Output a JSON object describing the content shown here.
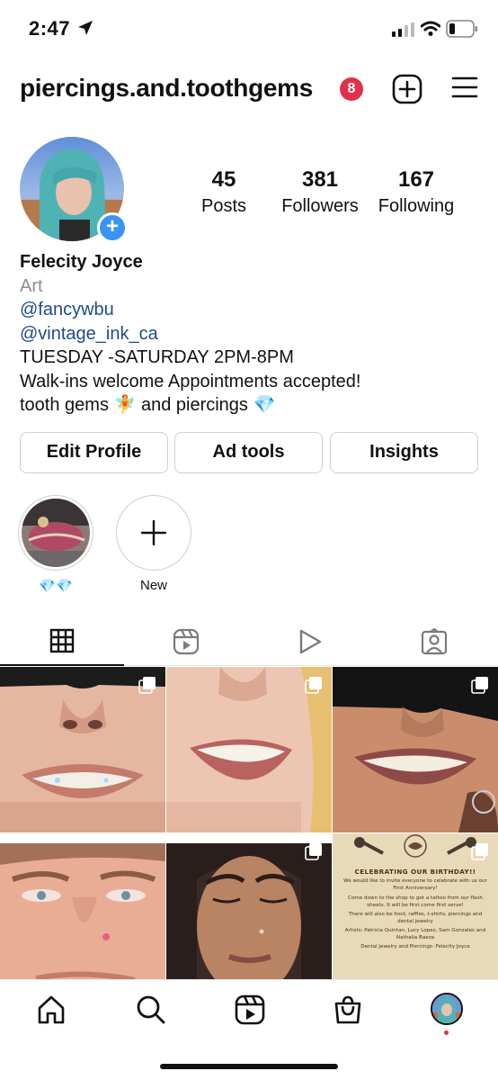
{
  "status_bar": {
    "time": "2:47"
  },
  "header": {
    "username": "piercings.and.toothgems",
    "notification_count": "8"
  },
  "profile": {
    "stats": [
      {
        "value": "45",
        "label": "Posts"
      },
      {
        "value": "381",
        "label": "Followers"
      },
      {
        "value": "167",
        "label": "Following"
      }
    ],
    "name": "Felecity Joyce",
    "category": "Art",
    "mentions": [
      "@fancywbu",
      "@vintage_ink_ca"
    ],
    "hours": "TUESDAY -SATURDAY 2PM-8PM",
    "bio_line_1": "Walk-ins welcome Appointments accepted!",
    "bio_line_2": "tooth gems 🧚 and piercings 💎"
  },
  "buttons": {
    "edit_profile": "Edit Profile",
    "ad_tools": "Ad tools",
    "insights": "Insights"
  },
  "highlights": [
    {
      "label": "💎💎"
    },
    {
      "label": "New"
    }
  ],
  "tabs": [
    "grid-tab",
    "reels-tab",
    "videos-tab",
    "tagged-tab"
  ],
  "poster": {
    "title": "CELEBRATING OUR BIRTHDAY!!",
    "line1": "We would like to invite everyone to celebrate with us our First Anniversary!",
    "line2": "Come down to the shop to get a tattoo from our flash sheets. It will be first come first serve!",
    "line3": "There will also be food, raffles, t-shirts, piercings and dental jewelry",
    "line4": "Artists: Patricia Quintan, Lucy Lopez, Sam Gonzales and Nathalia Baeza",
    "line5": "Dental Jewelry and Piercings- Felecity Joyce"
  },
  "colors": {
    "link": "#1f4a8a",
    "badge": "#e0304a",
    "add_badge": "#3b93f2"
  }
}
